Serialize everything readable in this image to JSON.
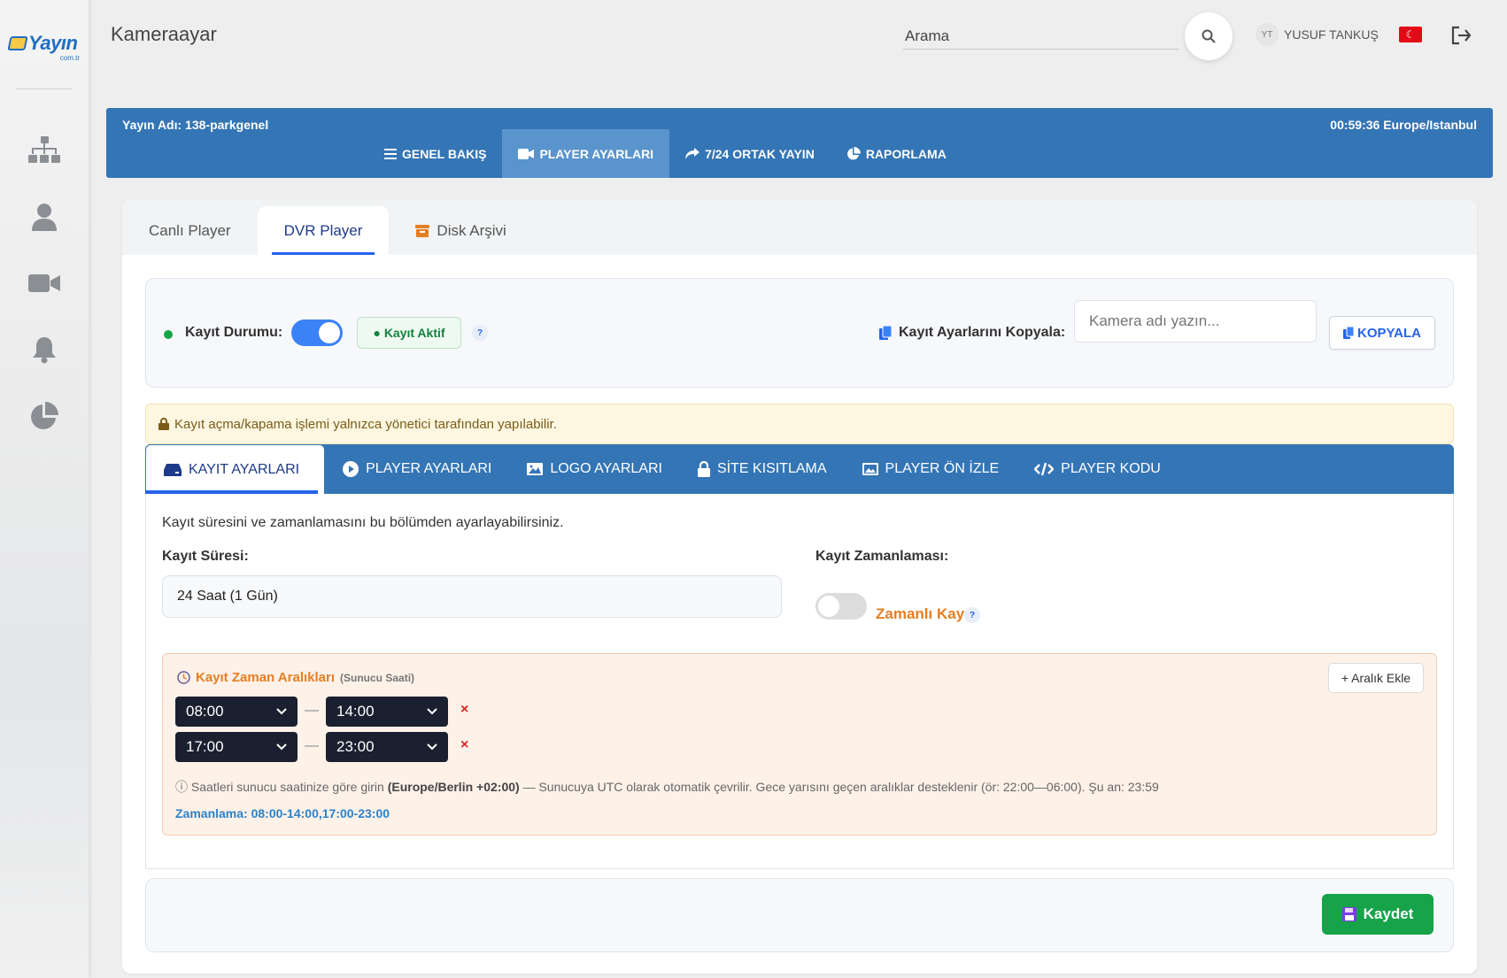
{
  "brand": {
    "logo_text": "Yayın",
    "logo_sub": "com.tr"
  },
  "header": {
    "title": "Kameraayar",
    "search_value": "Arama",
    "user_initials": "YT",
    "user_name": "YUSUF TANKUŞ",
    "flag": "☾"
  },
  "sidebar": {
    "icons": [
      "sitemap-icon",
      "user-icon",
      "video-camera-icon",
      "bell-icon",
      "pie-chart-icon"
    ]
  },
  "stream": {
    "name": "Yayın Adı: 138-parkgenel",
    "time": "00:59:36 Europe/Istanbul",
    "tabs": [
      {
        "label": "GENEL BAKIŞ",
        "icon": "list-icon"
      },
      {
        "label": "PLAYER AYARLARI",
        "icon": "video-icon",
        "active": true
      },
      {
        "label": "7/24 ORTAK YAYIN",
        "icon": "share-icon"
      },
      {
        "label": "RAPORLAMA",
        "icon": "pie-chart-icon"
      }
    ]
  },
  "top_tabs": [
    {
      "label": "Canlı Player"
    },
    {
      "label": "DVR Player",
      "active": true
    },
    {
      "label": "Disk Arşivi",
      "icon": "archive-icon"
    }
  ],
  "status": {
    "label": "Kayıt Durumu:",
    "badge": "● Kayıt Aktif",
    "help": "?",
    "copy_label": "Kayıt Ayarlarını Kopyala:",
    "copy_placeholder": "Kamera adı yazın...",
    "copy_button": "KOPYALA"
  },
  "warning": "Kayıt açma/kapama işlemi yalnızca yönetici tarafından yapılabilir.",
  "inner_tabs": [
    {
      "label": "KAYIT AYARLARI",
      "icon": "hdd-icon",
      "active": true
    },
    {
      "label": "PLAYER AYARLARI",
      "icon": "play-circle-icon"
    },
    {
      "label": "LOGO AYARLARI",
      "icon": "image-icon"
    },
    {
      "label": "SİTE KISITLAMA",
      "icon": "lock-icon"
    },
    {
      "label": "PLAYER ÖN İZLE",
      "icon": "preview-icon"
    },
    {
      "label": "PLAYER KODU",
      "icon": "code-icon"
    }
  ],
  "settings": {
    "description": "Kayıt süresini ve zamanlamasını bu bölümden ayarlayabilirsiniz.",
    "duration_label": "Kayıt Süresi:",
    "duration_value": "24 Saat (1 Gün)",
    "schedule_label": "Kayıt Zamanlaması:",
    "scheduled_label": "Zamanlı Kayıt",
    "scheduled_enabled": false
  },
  "ranges": {
    "title": "Kayıt Zaman Aralıkları",
    "subtitle": "(Sunucu Saati)",
    "add_button": "+ Aralık Ekle",
    "items": [
      {
        "start": "08:00",
        "end": "14:00"
      },
      {
        "start": "17:00",
        "end": "23:00"
      }
    ],
    "separator": "—",
    "remove": "×",
    "hint_pre": "ⓘ Saatleri sunucu saatinize göre girin ",
    "hint_bold": "(Europe/Berlin +02:00)",
    "hint_post": " — Sunucuya UTC olarak otomatik çevrilir. Gece yarısını geçen aralıklar desteklenir (ör: 22:00—06:00). Şu an: 23:59",
    "summary": "Zamanlama: 08:00-14:00,17:00-23:00"
  },
  "save_button": "Kaydet",
  "colors": {
    "primary_blue": "#3475b5",
    "accent_blue": "#2563eb",
    "success_green": "#16a34a",
    "orange": "#e67e22",
    "danger_red": "#dc2626"
  }
}
